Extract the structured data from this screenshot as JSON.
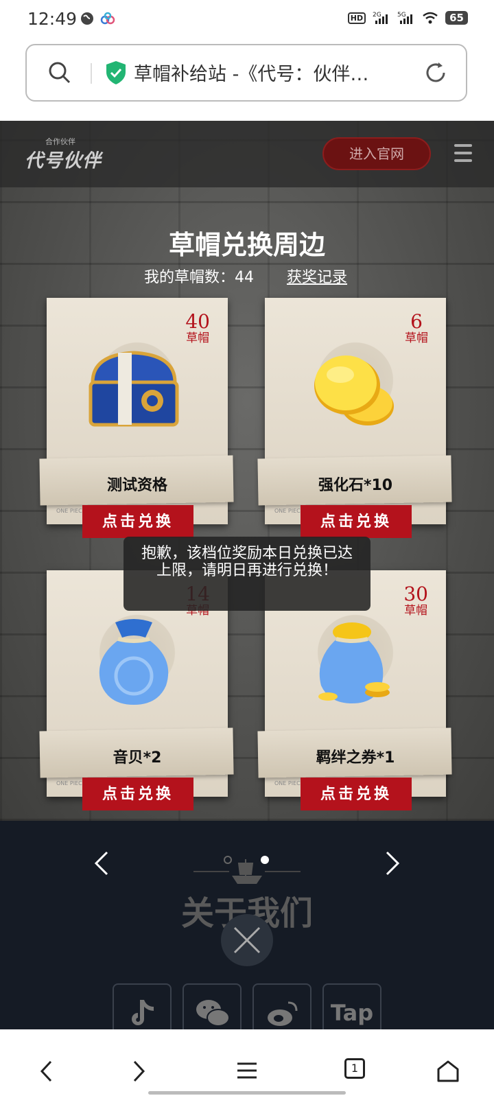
{
  "status_bar": {
    "time": "12:49",
    "battery": "65"
  },
  "address_bar": {
    "url_title": "草帽补给站 -《代号：伙伴…"
  },
  "header": {
    "logo_small": "合作伙伴",
    "logo_main": "代号伙伴",
    "official_button": "进入官网"
  },
  "main": {
    "title": "草帽兑换周边",
    "count_label": "我的草帽数：",
    "count_value": "44",
    "record_link": "获奖记录",
    "price_unit": "草帽",
    "redeem_label": "点击兑换",
    "watermark": "ONE PIECE",
    "items": [
      {
        "name": "测试资格",
        "price": "40"
      },
      {
        "name": "强化石*10",
        "price": "6"
      },
      {
        "name": "音贝*2",
        "price": "14"
      },
      {
        "name": "羁绊之券*1",
        "price": "30"
      }
    ],
    "toast": "抱歉，该档位奖励本日兑换已达上限，请明日再进行兑换！"
  },
  "footer": {
    "about": "关于我们",
    "social": [
      "tiktok-icon",
      "wechat-icon",
      "weibo-icon",
      "Tap"
    ]
  },
  "bottom_nav": {
    "tab_count": "1"
  },
  "colors": {
    "redeem_red": "#b4121c",
    "price_red": "#b3121b",
    "footer_bg": "#151b25",
    "shield_green": "#22b573"
  }
}
